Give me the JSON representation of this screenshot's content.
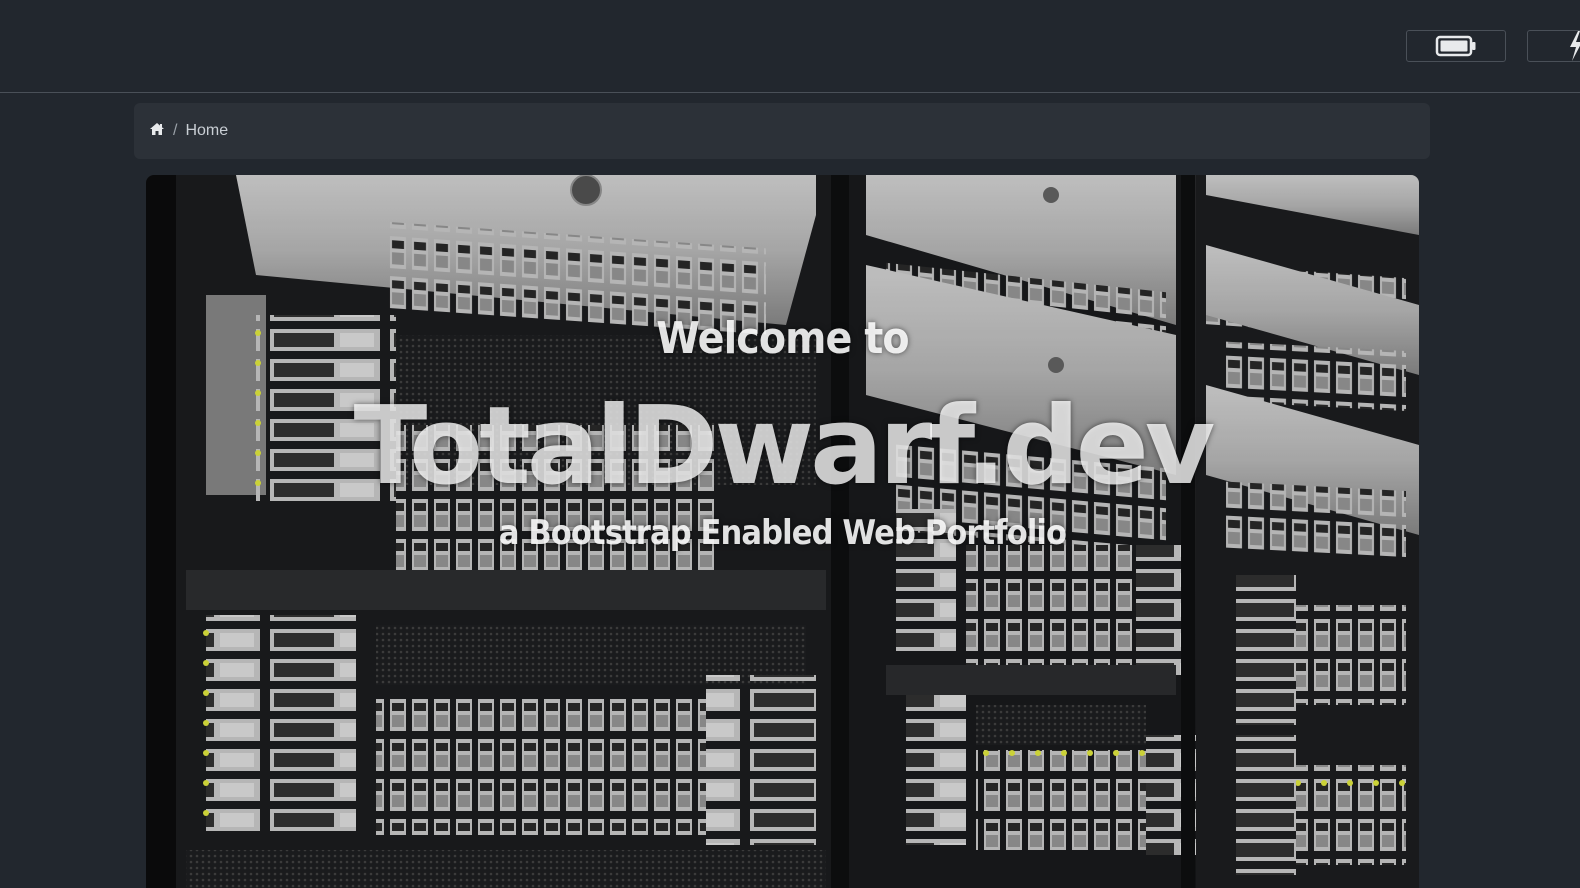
{
  "navbar": {
    "battery_icon": "battery-icon",
    "bolt_icon": "lightning-bolt-icon"
  },
  "breadcrumb": {
    "home_icon": "home-icon",
    "separator": "/",
    "current": "Home"
  },
  "hero": {
    "line1": "Welcome to",
    "brand": "TotalDwarf.dev",
    "tagline": "a Bootstrap Enabled Web Portfolio",
    "image": "server-rack-photo"
  },
  "colors": {
    "background": "#22272e",
    "panel": "#2c3138",
    "border": "#4a5058"
  }
}
